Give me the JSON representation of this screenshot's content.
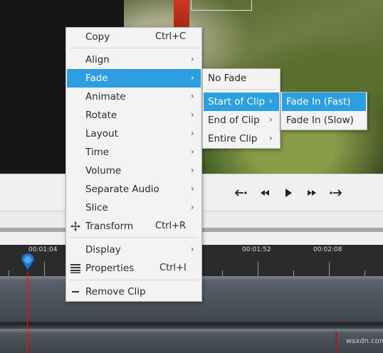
{
  "context_menu": {
    "copy": {
      "label": "Copy",
      "shortcut": "Ctrl+C"
    },
    "items": [
      {
        "label": "Align",
        "submenu": true
      },
      {
        "label": "Fade",
        "submenu": true
      },
      {
        "label": "Animate",
        "submenu": true
      },
      {
        "label": "Rotate",
        "submenu": true
      },
      {
        "label": "Layout",
        "submenu": true
      },
      {
        "label": "Time",
        "submenu": true
      },
      {
        "label": "Volume",
        "submenu": true
      },
      {
        "label": "Separate Audio",
        "submenu": true
      },
      {
        "label": "Slice",
        "submenu": true
      }
    ],
    "transform": {
      "label": "Transform",
      "shortcut": "Ctrl+R",
      "icon": "move-arrows-icon"
    },
    "display": {
      "label": "Display",
      "submenu": true
    },
    "properties": {
      "label": "Properties",
      "shortcut": "Ctrl+I",
      "icon": "list-lines-icon"
    },
    "remove_clip": {
      "label": "Remove Clip",
      "icon": "minus-icon"
    },
    "arrow_glyph": "›"
  },
  "fade_menu": {
    "items": [
      {
        "label": "No Fade",
        "submenu": false
      },
      {
        "label": "Start of Clip",
        "submenu": true
      },
      {
        "label": "End of Clip",
        "submenu": true
      },
      {
        "label": "Entire Clip",
        "submenu": true
      }
    ]
  },
  "start_of_clip_menu": {
    "items": [
      {
        "label": "Fade In (Fast)"
      },
      {
        "label": "Fade In (Slow)"
      }
    ]
  },
  "timeline": {
    "ruler_labels": [
      "00:01:04",
      "00:01:52",
      "00:02:08"
    ]
  },
  "playback_controls": {
    "icons": [
      "jump-start-icon",
      "rewind-icon",
      "play-icon",
      "fast-forward-icon",
      "jump-end-icon"
    ]
  },
  "watermark": "wsxdn.com",
  "colors": {
    "highlight": "#2c9fe0",
    "playhead": "#d21e1e",
    "menu_bg": "#f3f3f3"
  }
}
